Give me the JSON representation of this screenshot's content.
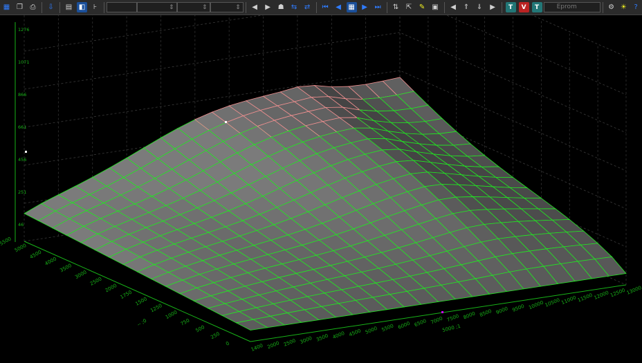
{
  "toolbar": {
    "icons": [
      "map-icon",
      "copy-icon",
      "print-icon",
      "import-icon",
      "table-view-icon",
      "color-select-icon",
      "axis-icon",
      "value-field-a",
      "value-field-b",
      "value-field-c",
      "prev-icon",
      "next-icon",
      "lock-icon",
      "compare-icon",
      "swap-icon",
      "first-icon",
      "back-icon",
      "grid-icon",
      "forward-icon",
      "last-icon",
      "sort-icon",
      "export-icon",
      "note-icon",
      "chart-icon",
      "prev-map-icon",
      "upload-icon",
      "download-icon",
      "next-map-icon",
      "tag-t-icon",
      "tag-v-icon",
      "tag-t2-icon",
      "settings-icon",
      "bulb-icon",
      "help-icon"
    ],
    "tag_t": "T",
    "tag_v": "V",
    "tag_t2": "T",
    "eprom_label": "Eprom"
  },
  "chart_data": {
    "type": "surface3d",
    "z_ticks": [
      "46",
      "251",
      "456",
      "661",
      "866",
      "1071",
      "1276"
    ],
    "y_ticks": [
      "5500",
      "5000",
      "4500",
      "4000",
      "3500",
      "3000",
      "2500",
      "2000",
      "1750",
      "1500",
      "1250",
      "1000",
      "750",
      "500",
      "250",
      "0"
    ],
    "x_ticks": [
      "1400",
      "2000",
      "2500",
      "3000",
      "3500",
      "4000",
      "4500",
      "5000",
      "5500",
      "6000",
      "6500",
      "7000",
      "7500",
      "8000",
      "8500",
      "9000",
      "9500",
      "10000",
      "10500",
      "11000",
      "11500",
      "12000",
      "12500",
      "13000"
    ],
    "x_axis_label": "5000 ;1",
    "y_axis_label": "-- ;0",
    "grid": true,
    "colors": {
      "mesh_low": "#22e622",
      "mesh_high": "#f09090",
      "face_light": "#8a8a8a",
      "face_dark": "#2a2a2a",
      "axis": "#18b418"
    }
  }
}
